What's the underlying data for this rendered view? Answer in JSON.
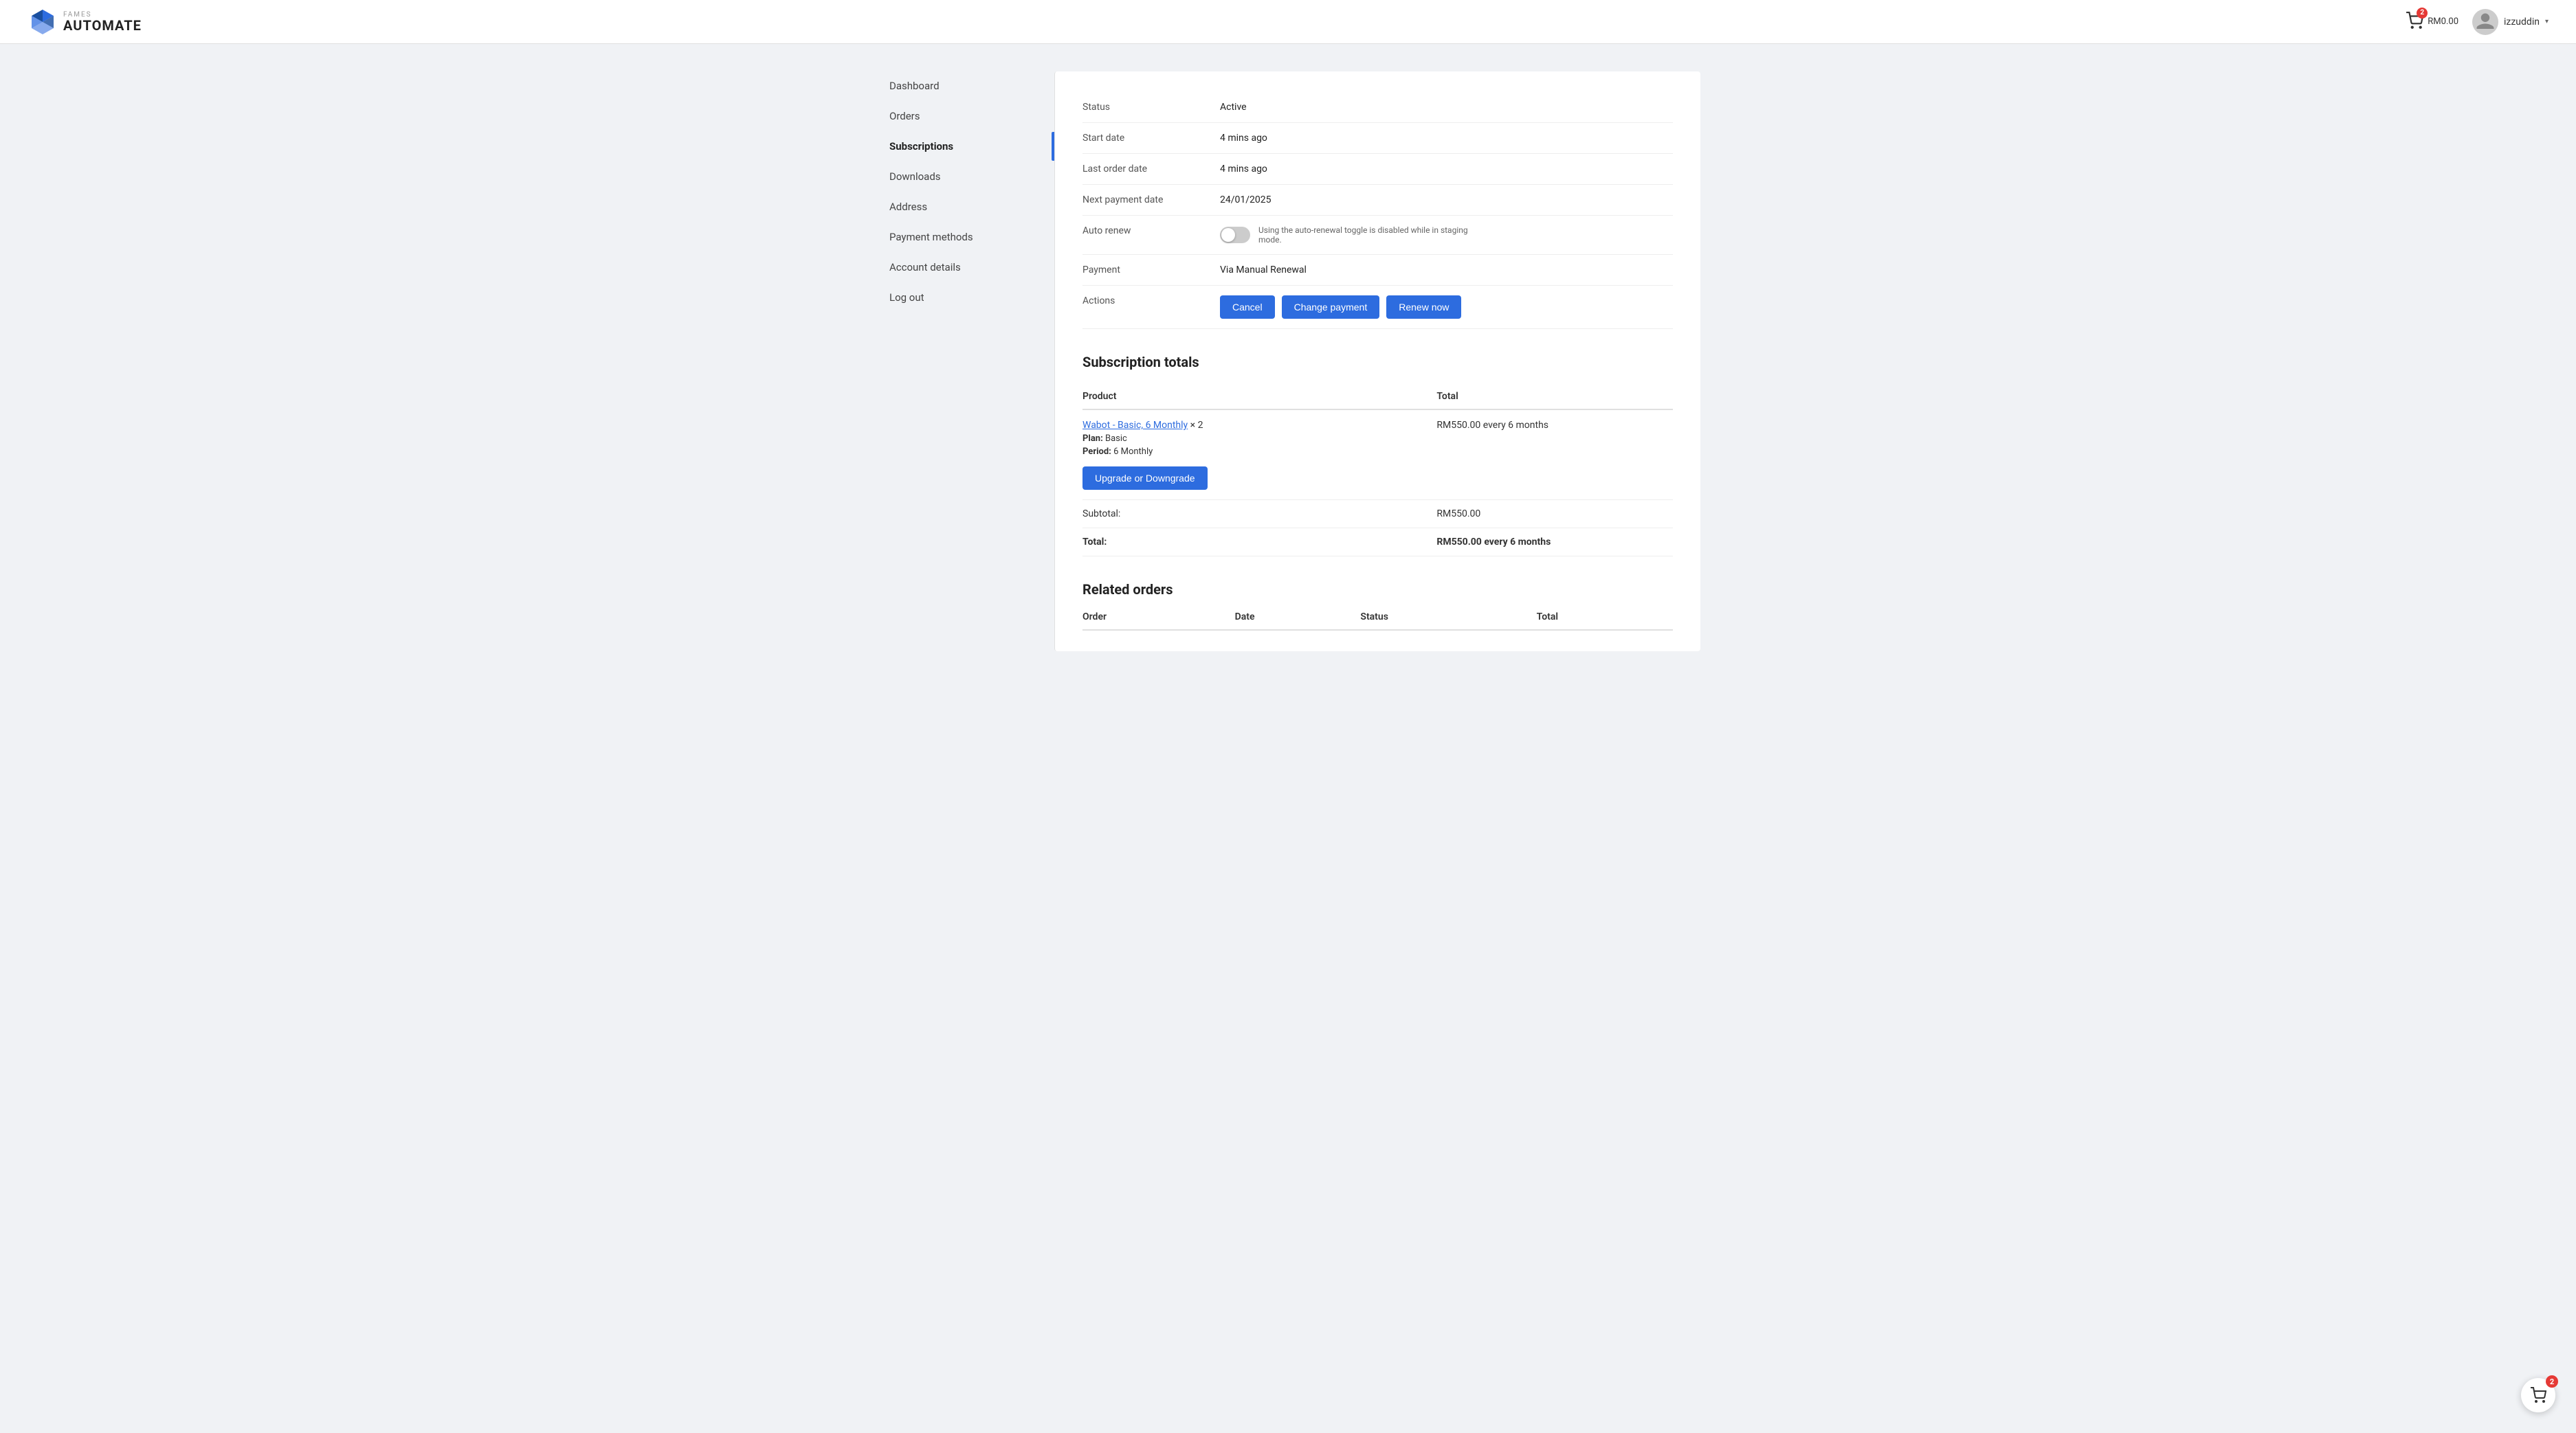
{
  "header": {
    "logo_fames": "FAMES",
    "logo_automate": "AUTOMATE",
    "cart_badge": "2",
    "cart_amount": "RM0.00",
    "username": "izzuddin",
    "chevron": "▾"
  },
  "sidebar": {
    "items": [
      {
        "id": "dashboard",
        "label": "Dashboard",
        "active": false
      },
      {
        "id": "orders",
        "label": "Orders",
        "active": false
      },
      {
        "id": "subscriptions",
        "label": "Subscriptions",
        "active": true
      },
      {
        "id": "downloads",
        "label": "Downloads",
        "active": false
      },
      {
        "id": "address",
        "label": "Address",
        "active": false
      },
      {
        "id": "payment-methods",
        "label": "Payment methods",
        "active": false
      },
      {
        "id": "account-details",
        "label": "Account details",
        "active": false
      },
      {
        "id": "log-out",
        "label": "Log out",
        "active": false
      }
    ]
  },
  "subscription": {
    "details": [
      {
        "label": "Status",
        "value": "Active"
      },
      {
        "label": "Start date",
        "value": "4 mins ago"
      },
      {
        "label": "Last order date",
        "value": "4 mins ago"
      },
      {
        "label": "Next payment date",
        "value": "24/01/2025"
      },
      {
        "label": "Auto renew",
        "type": "toggle",
        "note": "Using the auto-renewal toggle is disabled while in staging mode."
      },
      {
        "label": "Payment",
        "value": "Via Manual Renewal"
      }
    ],
    "actions": {
      "label": "Actions",
      "cancel": "Cancel",
      "change_payment": "Change payment",
      "renew_now": "Renew now"
    }
  },
  "subscription_totals": {
    "title": "Subscription totals",
    "columns": [
      "Product",
      "Total"
    ],
    "product": {
      "name": "Wabot - Basic, 6 Monthly",
      "quantity": "× 2",
      "plan_label": "Plan:",
      "plan_value": "Basic",
      "period_label": "Period:",
      "period_value": "6 Monthly",
      "total": "RM550.00 every 6 months",
      "upgrade_btn": "Upgrade or Downgrade"
    },
    "subtotal_label": "Subtotal:",
    "subtotal_value": "RM550.00",
    "total_label": "Total:",
    "total_value": "RM550.00 every 6 months"
  },
  "related_orders": {
    "title": "Related orders",
    "columns": [
      "Order",
      "Date",
      "Status",
      "Total"
    ]
  },
  "floating_cart": {
    "badge": "2"
  }
}
